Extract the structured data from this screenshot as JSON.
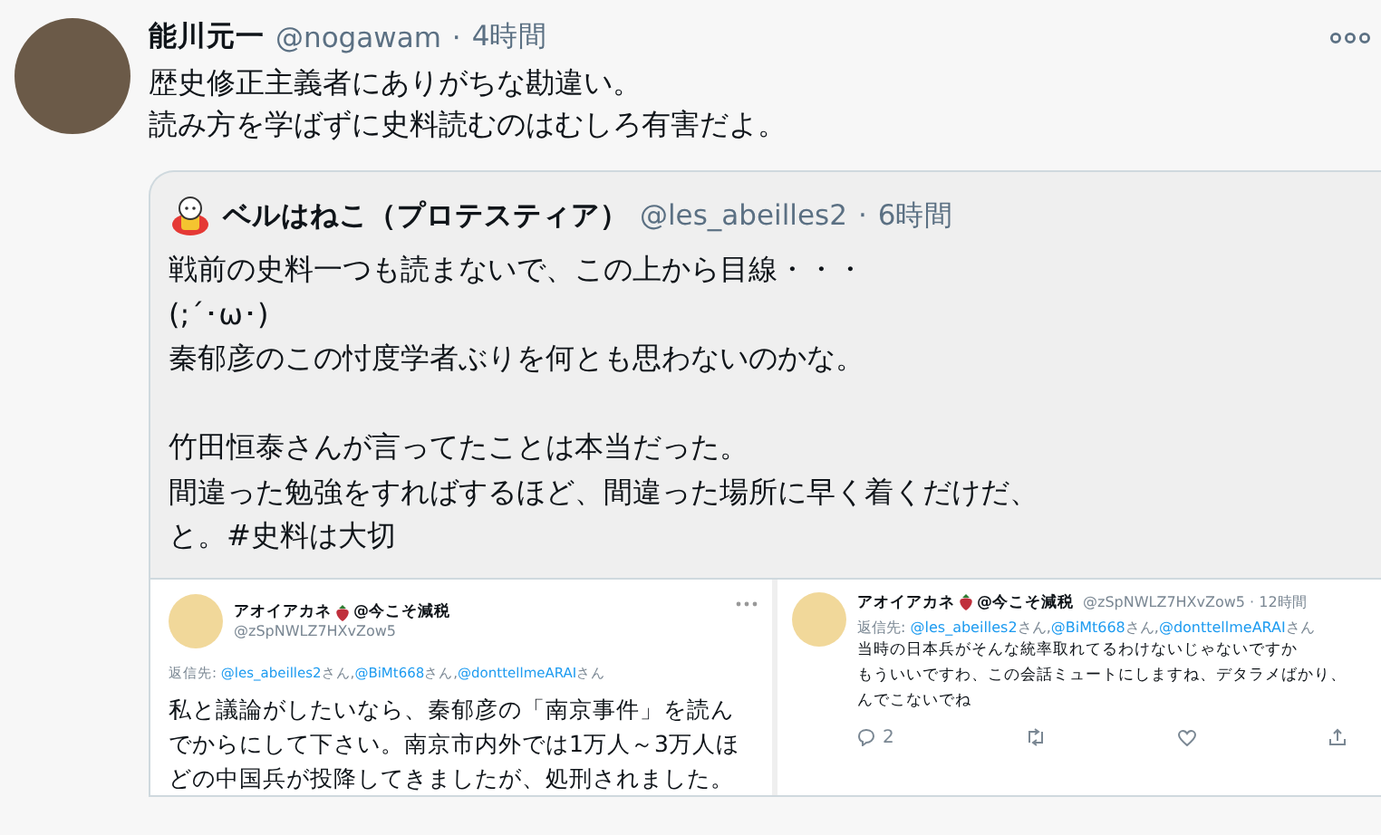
{
  "tweet": {
    "name": "能川元一",
    "handle": "@nogawam",
    "separator": "·",
    "time": "4時間",
    "lines": [
      "歴史修正主義者にありがちな勘違い。",
      "読み方を学ばずに史料読むのはむしろ有害だよ。"
    ],
    "quote": {
      "name": "ベルはねこ（プロテスティア）",
      "handle": "@les_abeilles2",
      "separator": "·",
      "time": "6時間",
      "paragraphs": [
        [
          "戦前の史料一つも読まないで、この上から目線・・・",
          "(;´･ω･)",
          "秦郁彦のこの忖度学者ぶりを何とも思わないのかな。"
        ],
        [
          "竹田恒泰さんが言ってたことは本当だった。",
          "間違った勉強をすればするほど、間違った場所に早く着くだけだ、",
          "と。#史料は大切"
        ]
      ],
      "images": [
        {
          "kind": "card",
          "name": "アオイアカネ",
          "name_suffix": "@今こそ減税",
          "handle": "@zSpNWLZ7HXvZow5",
          "reply_label": "返信先:",
          "mentions": [
            {
              "handle": "@les_abeilles2",
              "suffix": "さん,"
            },
            {
              "handle": "@BiMt668",
              "suffix": "さん,"
            },
            {
              "handle": "@donttellmeARAI",
              "suffix": "さん"
            }
          ],
          "lines": [
            "私と議論がしたいなら、秦郁彦の「南京事件」を読ん",
            "でからにして下さい。南京市内外では1万人～3万人ほ",
            "どの中国兵が投降してきましたが、処刑されました。"
          ]
        },
        {
          "kind": "inline",
          "name": "アオイアカネ",
          "name_suffix": "@今こそ減税",
          "handle": "@zSpNWLZ7HXvZow5",
          "separator": "·",
          "time": "12時間",
          "reply_label": "返信先:",
          "mentions": [
            {
              "handle": "@les_abeilles2",
              "suffix": "さん,"
            },
            {
              "handle": "@BiMt668",
              "suffix": "さん,"
            },
            {
              "handle": "@donttellmeARAI",
              "suffix": "さん"
            }
          ],
          "lines": [
            "当時の日本兵がそんな統率取れてるわけないじゃないですか",
            "もういいですわ、この会話ミュートにしますね、デタラメばかり、",
            "んでこないでね"
          ],
          "reply_count": "2"
        }
      ]
    }
  }
}
